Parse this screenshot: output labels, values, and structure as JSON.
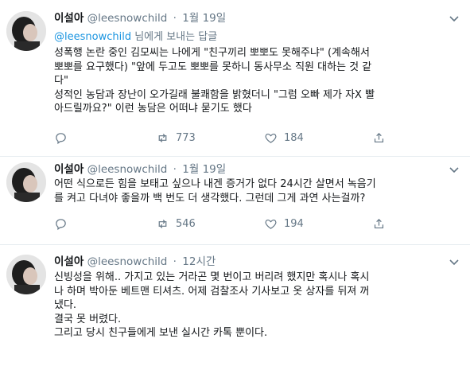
{
  "tweets": [
    {
      "name": "이설아",
      "handle": "@leesnowchild",
      "separator": "·",
      "time": "1월 19일",
      "reply_to": {
        "mention": "@leesnowchild",
        "suffix": " 님에게 보내는 답글"
      },
      "text": "성폭행 논란 중인 김모씨는 나에게 \"친구끼리 뽀뽀도 못해주냐\" (계속해서\n뽀뽀를 요구했다) \"앞에 두고도 뽀뽀를 못하니 동사무소 직원 대하는 것 같\n다\"\n성적인 농담과 장난이 오가길래 불쾌함을 밝혔더니 \"그럼 오빠 제가 자X 빨\n아드릴까요?\" 이런 농담은 어떠냐 묻기도 했다",
      "retweets": "773",
      "likes": "184"
    },
    {
      "name": "이설아",
      "handle": "@leesnowchild",
      "separator": "·",
      "time": "1월 19일",
      "text": "어떤 식으로든 힘을 보태고 싶으나 내겐 증거가 없다 24시간 살면서 녹음기\n를 켜고 다녀야 좋을까 백 번도 더 생각했다. 그런데 그게 과연 사는걸까?",
      "retweets": "546",
      "likes": "194"
    },
    {
      "name": "이설아",
      "handle": "@leesnowchild",
      "separator": "·",
      "time": "12시간",
      "text": "신빙성을 위해.. 가지고 있는 거라곤 몇 번이고 버리려 했지만 혹시나 혹시\n나 하며 박아둔 베트맨 티셔츠. 어제 검찰조사 기사보고 옷 상자를 뒤져 꺼\n냈다.\n결국 못 버렸다.\n그리고 당시 친구들에게 보낸 실시간 카톡 뿐이다."
    }
  ],
  "icons": {
    "reply": "reply-icon",
    "retweet": "retweet-icon",
    "like": "heart-icon",
    "share": "share-icon",
    "more": "chevron-down-icon"
  },
  "colors": {
    "text": "#14171a",
    "muted": "#657786",
    "link": "#1b95e0",
    "divider": "#e6ecf0"
  }
}
